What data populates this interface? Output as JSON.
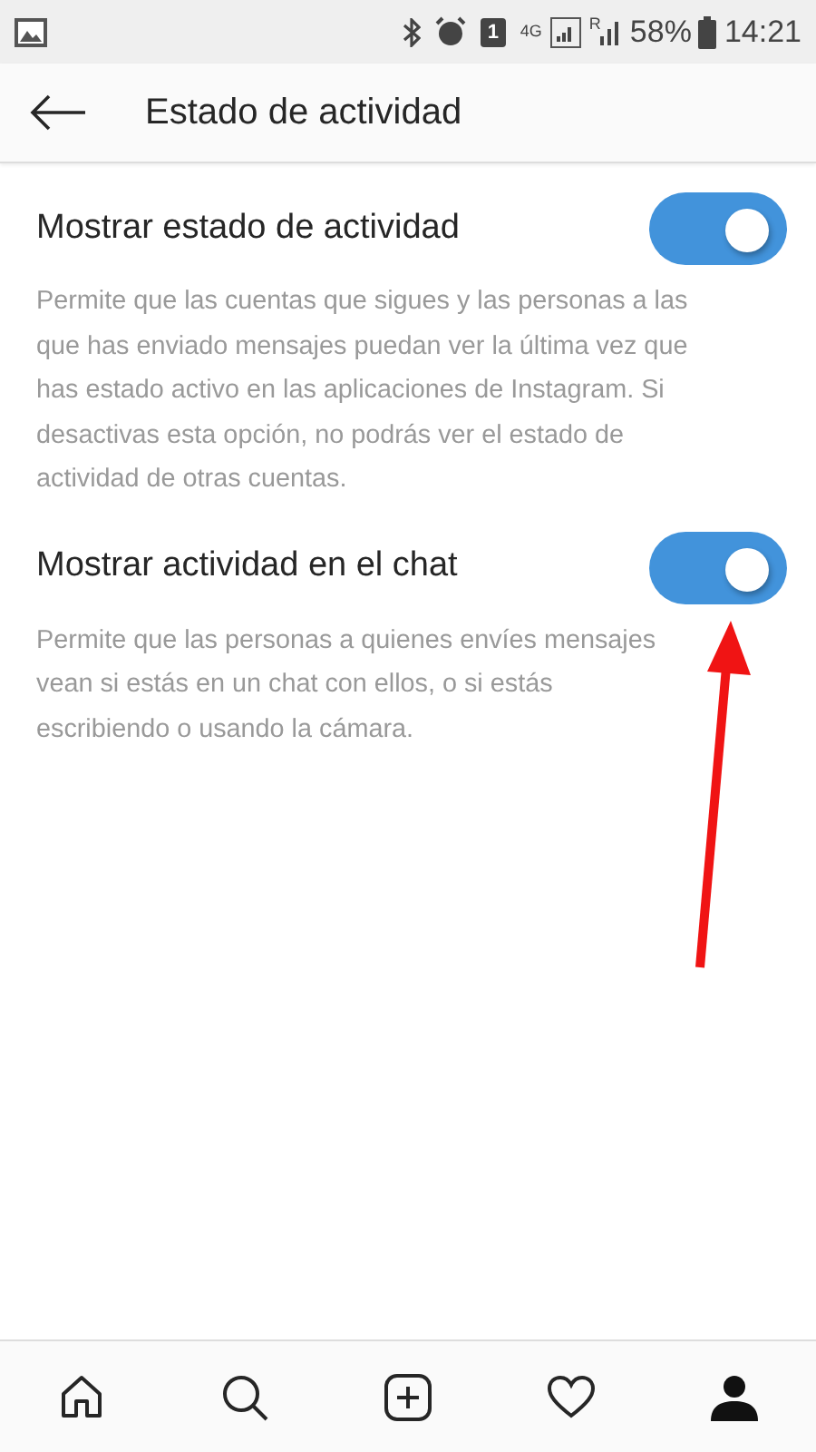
{
  "status_bar": {
    "sim": "1",
    "network": "4G",
    "roaming": "R",
    "battery": "58%",
    "time": "14:21"
  },
  "header": {
    "title": "Estado de actividad"
  },
  "settings": [
    {
      "title": "Mostrar estado de actividad",
      "on": true,
      "description": "Permite que las cuentas que sigues y las personas a las que has enviado mensajes puedan ver la última vez que has estado activo en las aplicaciones de Instagram. Si desactivas esta opción, no podrás ver el estado de actividad de otras cuentas."
    },
    {
      "title": "Mostrar actividad en el chat",
      "on": true,
      "description": "Permite que las personas a quienes envíes mensajes vean si estás en un chat con ellos, o si estás escribiendo o usando la cámara."
    }
  ],
  "bottom_nav": [
    {
      "kind": "home"
    },
    {
      "kind": "search"
    },
    {
      "kind": "add"
    },
    {
      "kind": "heart"
    },
    {
      "kind": "profile"
    }
  ]
}
